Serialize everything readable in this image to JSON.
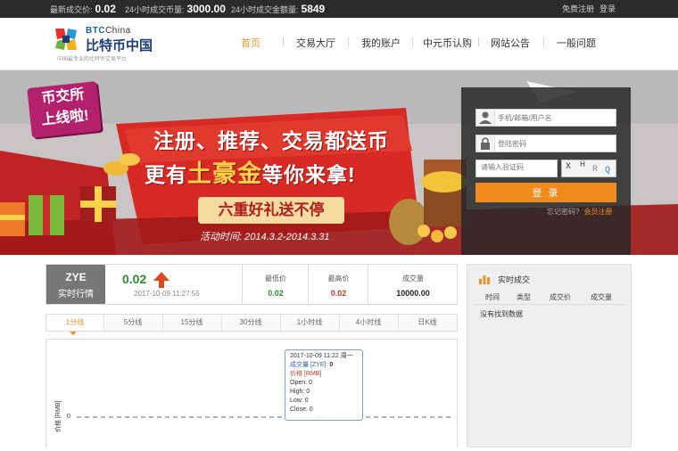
{
  "topbar": {
    "last_price_label": "最新成交价:",
    "last_price_value": "0.02",
    "volume_24h_label": "24小时成交币量:",
    "volume_24h_value": "3000.00",
    "amount_24h_label": "24小时成交金额量:",
    "amount_24h_value": "5849",
    "register_link": "免费注册",
    "login_link": "登录"
  },
  "brand": {
    "name_en_bold": "BTC",
    "name_en_light": "China",
    "name_cn": "比特币中国",
    "tagline": "中国最专业的比特币交易平台"
  },
  "nav": {
    "items": [
      {
        "label": "首页",
        "active": true
      },
      {
        "label": "交易大厅"
      },
      {
        "label": "我的账户"
      },
      {
        "label": "中元币认购"
      },
      {
        "label": "网站公告"
      },
      {
        "label": "一般问题"
      }
    ]
  },
  "banner": {
    "badge_line1": "币交所",
    "badge_line2": "上线啦!",
    "headline1": "注册、推荐、交易都送币",
    "headline2_pre": "更有",
    "headline2_gold": "土豪金",
    "headline2_post": "等你来拿!",
    "ribbon": "六重好礼送不停",
    "event_time": "活动时间: 2014.3.2-2014.3.31",
    "slide_count": 2,
    "active_slide": 1
  },
  "login": {
    "username_placeholder": "手机/邮箱/用户名",
    "password_placeholder": "登陆密码",
    "captcha_placeholder": "请输入验证码",
    "captcha_chars": [
      "X",
      "H",
      "R",
      "Q"
    ],
    "submit_label": "登 录",
    "forgot_label": "忘记密码?",
    "register_label": "会员注册"
  },
  "market": {
    "coin_code": "ZYE",
    "coin_sub": "实时行情",
    "price": "0.02",
    "price_trend": "up",
    "time": "2017-10-09 11:27:55",
    "stats": [
      {
        "label": "最低价",
        "value": "0.02",
        "color": "#2f8f2f"
      },
      {
        "label": "最高价",
        "value": "0.02",
        "color": "#c0392b"
      },
      {
        "label": "成交量",
        "value": "10000.00",
        "color": "#222222"
      }
    ]
  },
  "kline_tabs": {
    "items": [
      "1分线",
      "5分线",
      "15分线",
      "30分线",
      "1小时线",
      "4小时线",
      "日K线"
    ],
    "active": 0
  },
  "chart_data": {
    "type": "line",
    "ylabel": "价格 [RMB]",
    "y_tick_labels": [
      "0"
    ],
    "x": [
      "2017-10-09 11:22"
    ],
    "series": [
      {
        "name": "价格 [RMB]",
        "values": [
          0
        ]
      }
    ],
    "tooltip": {
      "header": "2017-10-09 11:22 周一",
      "volume_label": "成交量 [ZYE]:",
      "volume_value": "0",
      "price_label": "价格 [RMB]",
      "open": "Open: 0",
      "high": "High: 0",
      "low": "Low: 0",
      "close": "Close: 0"
    }
  },
  "trades": {
    "title": "实时成交",
    "columns": [
      "时间",
      "类型",
      "成交价",
      "成交量"
    ],
    "empty_message": "没有找到数据"
  },
  "colors": {
    "accent_orange": "#f08a1c",
    "nav_active": "#e8952b",
    "price_up_green": "#2f8f2f",
    "price_red": "#c0392b",
    "banner_red": "#d72a25"
  }
}
